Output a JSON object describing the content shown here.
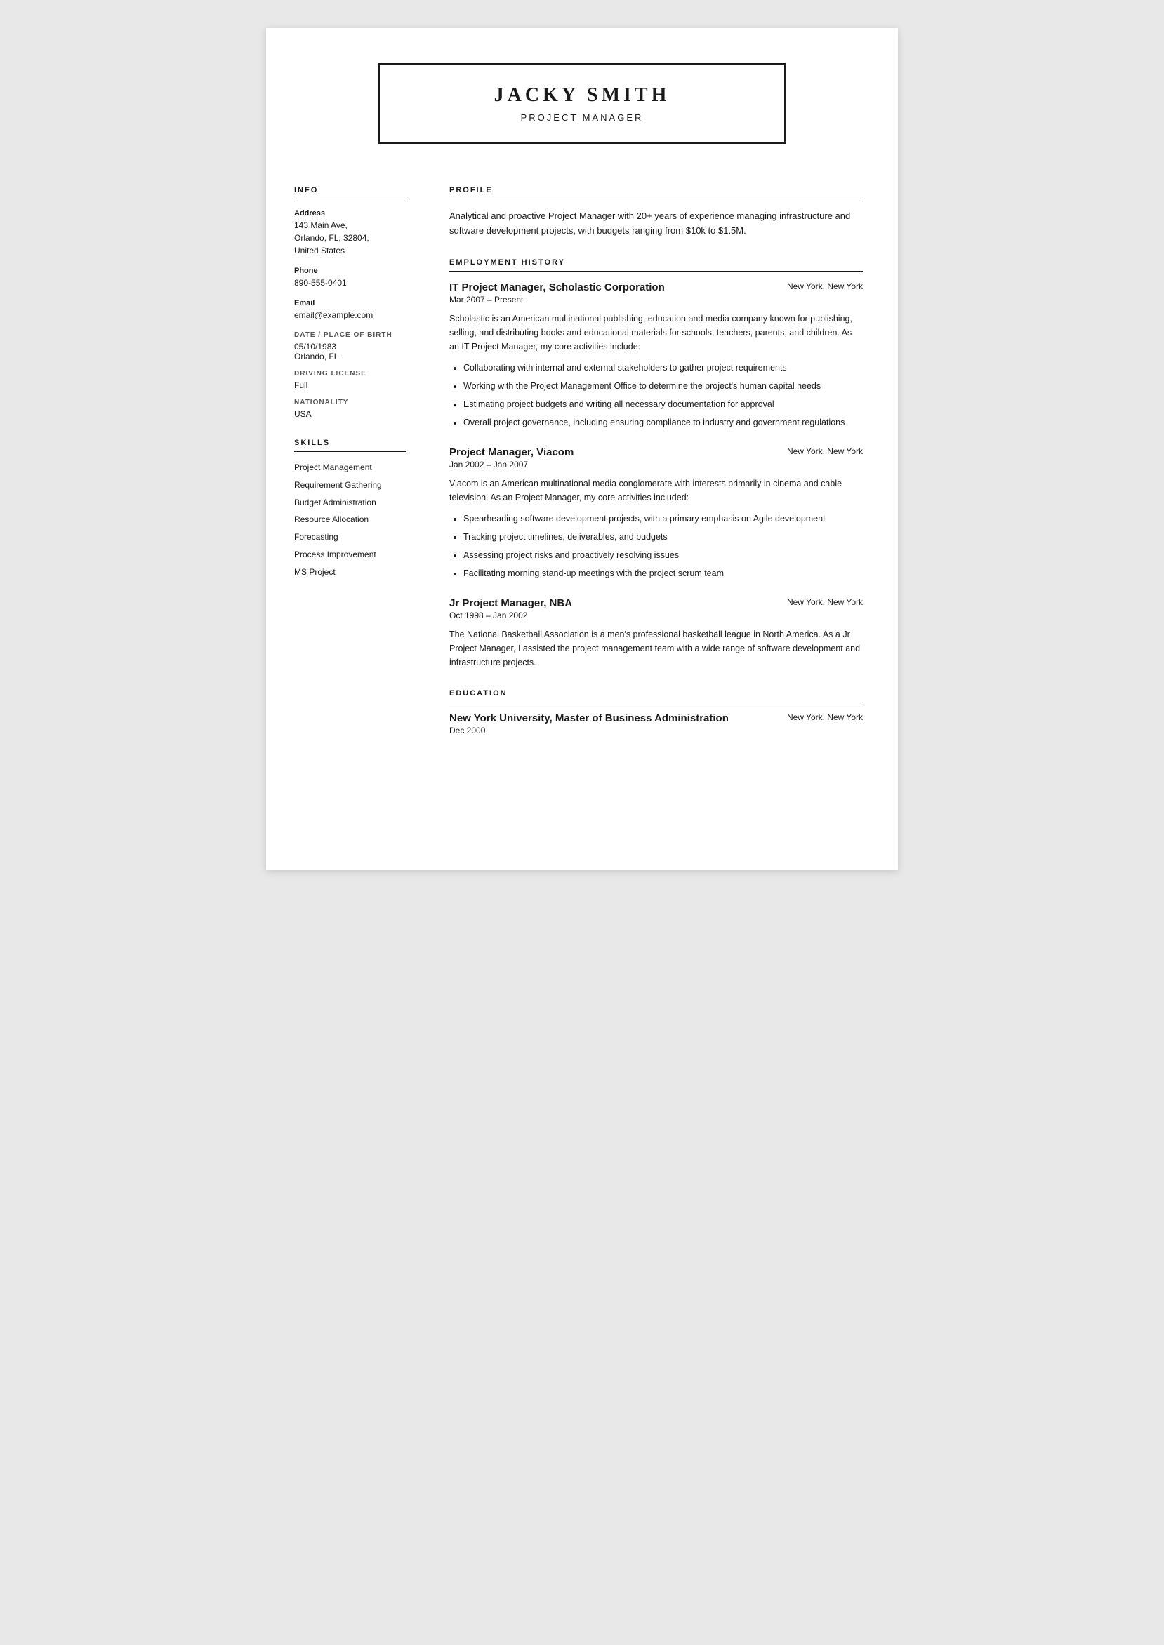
{
  "header": {
    "name": "JACKY SMITH",
    "title": "PROJECT MANAGER"
  },
  "sidebar": {
    "info_section_title": "INFO",
    "address_label": "Address",
    "address_value": "143 Main Ave, Orlando, FL, 32804, United States",
    "phone_label": "Phone",
    "phone_value": "890-555-0401",
    "email_label": "Email",
    "email_value": "email@example.com",
    "dob_label": "DATE / PLACE OF BIRTH",
    "dob_value": "05/10/1983",
    "dob_place": "Orlando, FL",
    "license_label": "DRIVING LICENSE",
    "license_value": "Full",
    "nationality_label": "NATIONALITY",
    "nationality_value": "USA",
    "skills_section_title": "SKILLS",
    "skills": [
      "Project Management",
      "Requirement Gathering",
      "Budget Administration",
      "Resource Allocation",
      "Forecasting",
      "Process Improvement",
      "MS Project"
    ]
  },
  "main": {
    "profile_section_title": "PROFILE",
    "profile_text": "Analytical and proactive Project Manager with 20+ years of experience managing infrastructure and software development projects, with budgets ranging from $10k to $1.5M.",
    "employment_section_title": "EMPLOYMENT HISTORY",
    "jobs": [
      {
        "title": "IT Project Manager, Scholastic Corporation",
        "location": "New York, New York",
        "dates": "Mar 2007 – Present",
        "description": "Scholastic is an American multinational publishing, education and media company known for publishing, selling, and distributing books and educational materials for schools, teachers, parents, and children. As an IT Project Manager, my core activities include:",
        "bullets": [
          "Collaborating with internal and external stakeholders to gather project requirements",
          "Working with the Project Management Office to determine the project's human capital needs",
          "Estimating project budgets and writing all necessary documentation for approval",
          "Overall project governance, including ensuring compliance to industry and government regulations"
        ]
      },
      {
        "title": "Project Manager, Viacom",
        "location": "New York, New York",
        "dates": "Jan 2002 – Jan 2007",
        "description": "Viacom is an American multinational media conglomerate with interests primarily in cinema and cable television. As an Project Manager, my core activities included:",
        "bullets": [
          "Spearheading software development projects, with a primary emphasis on Agile development",
          "Tracking project timelines, deliverables, and budgets",
          "Assessing project risks and proactively resolving issues",
          "Facilitating morning stand-up meetings with the project scrum team"
        ]
      },
      {
        "title": "Jr Project Manager, NBA",
        "location": "New York, New York",
        "dates": "Oct 1998 – Jan 2002",
        "description": "The National Basketball Association is a men's professional basketball league in North America. As a Jr Project Manager, I assisted the project management team with a wide range of software development and infrastructure projects.",
        "bullets": []
      }
    ],
    "education_section_title": "EDUCATION",
    "education": [
      {
        "title": "New York University, Master of Business Administration",
        "location": "New York, New York",
        "dates": "Dec 2000"
      }
    ]
  }
}
